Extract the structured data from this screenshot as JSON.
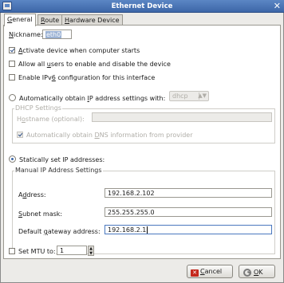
{
  "window": {
    "title": "Ethernet Device"
  },
  "tabs": [
    {
      "pre": "",
      "u": "G",
      "post": "eneral"
    },
    {
      "pre": "",
      "u": "R",
      "post": "oute"
    },
    {
      "pre": "",
      "u": "H",
      "post": "ardware Device"
    }
  ],
  "general": {
    "nickname_pre": "",
    "nickname_u": "N",
    "nickname_post": "ickname:",
    "nickname_value": "eth0",
    "activate_pre": "",
    "activate_u": "A",
    "activate_post": "ctivate device when computer starts",
    "allow_pre": "Allow all ",
    "allow_u": "u",
    "allow_post": "sers to enable and disable the device",
    "ipv6_pre": "Enable IPv",
    "ipv6_u": "6",
    "ipv6_post": " configuration for this interface",
    "auto_pre": "Automatically obtain ",
    "auto_u": "I",
    "auto_post": "P address settings with:",
    "auto_method": "dhcp",
    "dhcp_group": "DHCP Settings",
    "hostname_pre": "H",
    "hostname_u": "o",
    "hostname_post": "stname (optional):",
    "dns_pre": "Automatically obtain ",
    "dns_u": "D",
    "dns_post": "NS information from provider",
    "static_label": "Statically set IP addresses:",
    "manual_group": "Manual IP Address Settings",
    "address_pre": "A",
    "address_u": "d",
    "address_post": "dress:",
    "address_value": "192.168.2.102",
    "subnet_pre": "",
    "subnet_u": "S",
    "subnet_post": "ubnet mask:",
    "subnet_value": "255.255.255.0",
    "gateway_pre": "Default ",
    "gateway_u": "g",
    "gateway_post": "ateway address:",
    "gateway_value": "192.168.2.1",
    "mtu_label": "Set MTU to:",
    "mtu_value": "1"
  },
  "buttons": {
    "cancel_u": "C",
    "cancel_post": "ancel",
    "ok_u": "O",
    "ok_post": "K"
  }
}
